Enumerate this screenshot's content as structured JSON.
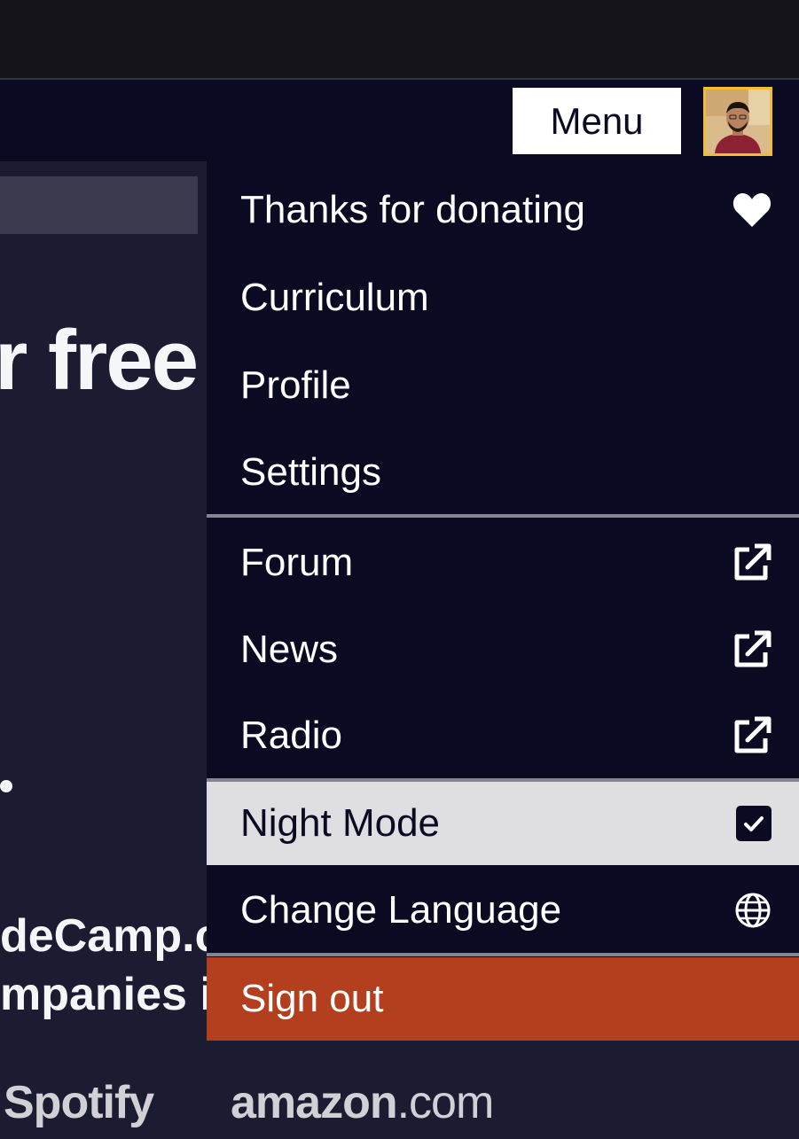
{
  "header": {
    "menu_label": "Menu"
  },
  "hero": {
    "title_fragment": "r free",
    "line1_fragment": "deCamp.c",
    "line2_fragment": "mpanies i"
  },
  "logos": {
    "spotify": "Spotify",
    "amazon_main": "amazon",
    "amazon_tld": ".com"
  },
  "menu": {
    "items": [
      {
        "label": "Thanks for donating",
        "icon": "heart-icon"
      },
      {
        "label": "Curriculum"
      },
      {
        "label": "Profile"
      },
      {
        "label": "Settings"
      },
      {
        "label": "Forum",
        "icon": "external-link-icon"
      },
      {
        "label": "News",
        "icon": "external-link-icon"
      },
      {
        "label": "Radio",
        "icon": "external-link-icon"
      },
      {
        "label": "Night Mode",
        "icon": "checkbox-checked-icon",
        "checked": true
      },
      {
        "label": "Change Language",
        "icon": "globe-icon"
      },
      {
        "label": "Sign out"
      }
    ]
  },
  "colors": {
    "navbar": "#0a0a23",
    "night_mode_bg": "#dfdfe2",
    "signout_bg": "#b33f1e",
    "avatar_border": "#f1be32"
  }
}
